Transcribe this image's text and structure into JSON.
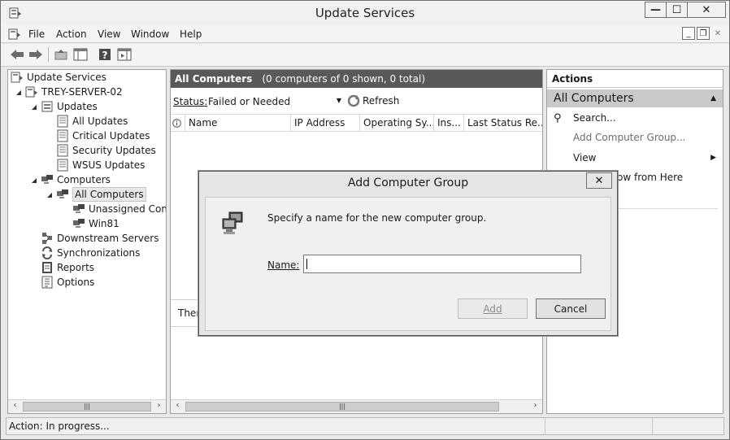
{
  "window": {
    "title": "Update Services"
  },
  "menu": {
    "items": [
      "File",
      "Action",
      "View",
      "Window",
      "Help"
    ]
  },
  "tree": {
    "root": "Update Services",
    "server": "TREY-SERVER-02",
    "updates": "Updates",
    "all_updates": "All Updates",
    "critical_updates": "Critical Updates",
    "security_updates": "Security Updates",
    "wsus_updates": "WSUS Updates",
    "computers": "Computers",
    "all_computers": "All Computers",
    "unassigned": "Unassigned Comp",
    "win81": "Win81",
    "downstream": "Downstream Servers",
    "synchronizations": "Synchronizations",
    "reports": "Reports",
    "options": "Options"
  },
  "main": {
    "header_title": "All Computers",
    "header_count": "(0 computers of 0 shown, 0 total)",
    "status_label": "Status:",
    "status_value": "Failed or Needed",
    "refresh_label": "Refresh",
    "columns": [
      "Name",
      "IP Address",
      "Operating Sy...",
      "Ins...",
      "Last Status Re..."
    ],
    "lower_text": "There"
  },
  "actions": {
    "header": "Actions",
    "group": "All Computers",
    "search": "Search...",
    "add_group": "Add Computer Group...",
    "view": "View",
    "new_window": "ow from Here"
  },
  "statusbar": {
    "text": "Action:  In progress..."
  },
  "dialog": {
    "title": "Add Computer Group",
    "message": "Specify a name for the new computer group.",
    "name_label": "Name:",
    "name_value": "",
    "add_button": "Add",
    "cancel_button": "Cancel"
  }
}
